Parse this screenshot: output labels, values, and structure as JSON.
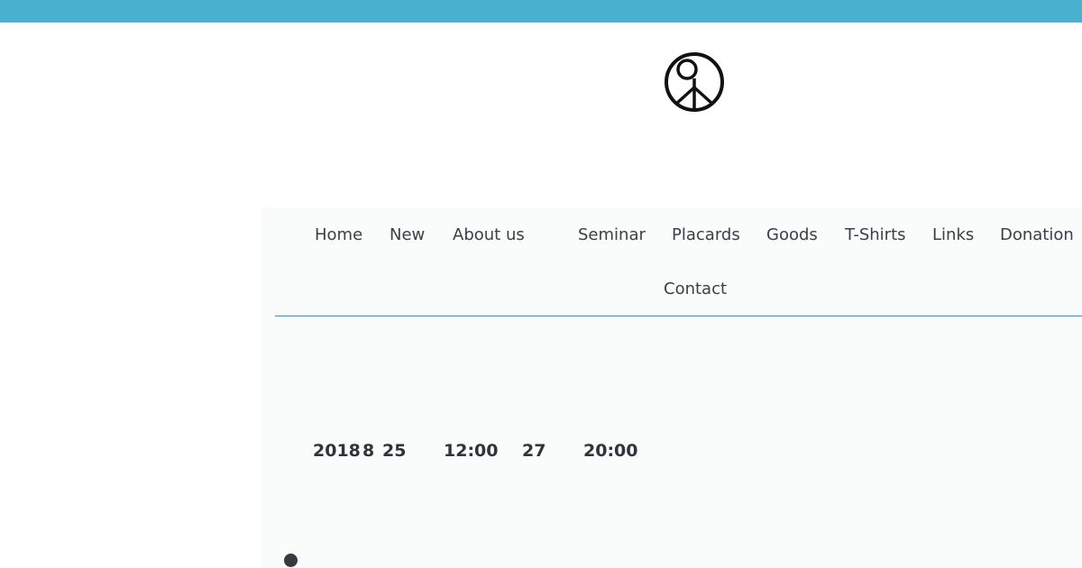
{
  "nav": {
    "home": "Home",
    "new": "New",
    "about": "About us",
    "seminar": "Seminar",
    "placards": "Placards",
    "goods": "Goods",
    "tshirts": "T-Shirts",
    "links": "Links",
    "donation": "Donation",
    "contact": "Contact"
  },
  "event": {
    "year": "2018",
    "month": "8",
    "day_start": "25",
    "time_start": "12:00",
    "day_end": "27",
    "time_end": "20:00"
  },
  "colors": {
    "top_bar": "#4ab0d0",
    "divider": "#4a86a8",
    "text": "#3a4045"
  },
  "icons": {
    "logo": "peace-symbol-icon",
    "bullet": "bullet-dot-icon"
  }
}
